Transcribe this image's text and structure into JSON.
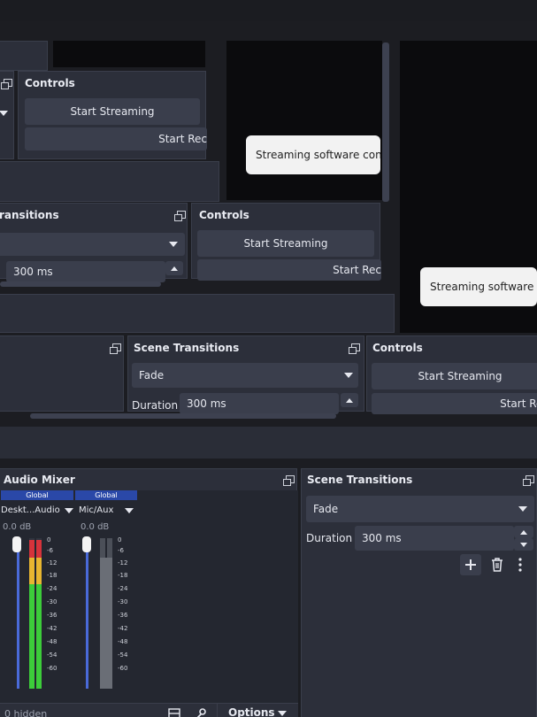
{
  "controls": {
    "title": "Controls",
    "start_streaming": "Start Streaming",
    "start_recording_partial": "Start Rec"
  },
  "scene_transitions": {
    "title": "Scene Transitions",
    "title_partial": "ransitions",
    "selected": "Fade",
    "duration_label": "Duration",
    "duration_value": "300 ms"
  },
  "tooltip": {
    "text_1": "Streaming software con",
    "text_2": "Streaming software c"
  },
  "audio_mixer": {
    "title": "Audio Mixer",
    "channels": [
      {
        "badge": "Global",
        "name": "Deskt...Audio",
        "db": "0.0 dB",
        "muted": false
      },
      {
        "badge": "Global",
        "name": "Mic/Aux",
        "db": "0.0 dB",
        "muted": true
      }
    ],
    "scale": [
      "0",
      "-6",
      "-12",
      "-18",
      "-24",
      "-30",
      "-36",
      "-42",
      "-48",
      "-54",
      "-60"
    ]
  },
  "status": {
    "hidden_count": "0 hidden",
    "options_label": "Options"
  },
  "colors": {
    "panel": "#2c2f3a",
    "control": "#3a3e4c",
    "meter_green": "#3ccd3a",
    "meter_yellow": "#e8b630",
    "meter_red": "#d6333b",
    "slider_blue": "#4a6ad8",
    "badge_blue": "#2a48a8",
    "mute_red": "#e04848"
  }
}
